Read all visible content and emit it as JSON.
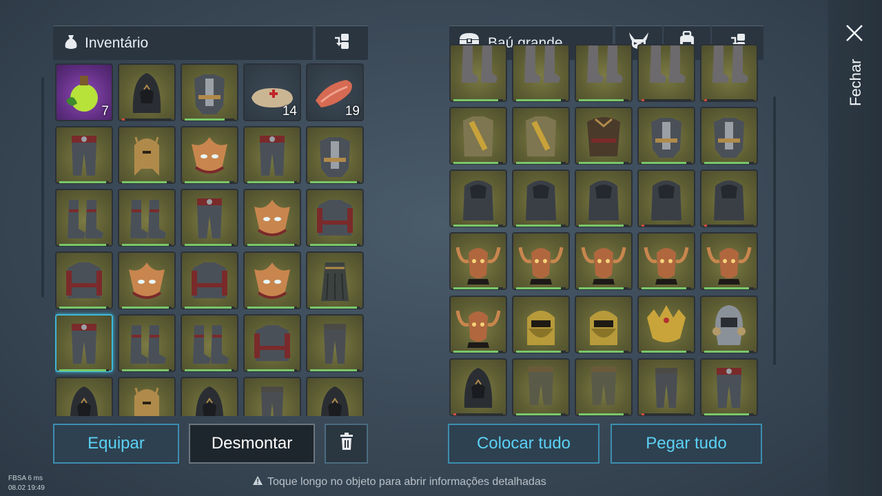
{
  "inventory": {
    "title": "Inventário",
    "icon": "pouch-icon",
    "sort_icon": "sort-icon",
    "items": [
      {
        "kind": "potion",
        "rarity": "rare",
        "qty": "7"
      },
      {
        "kind": "hood",
        "rarity": "normal",
        "durability": 0.05
      },
      {
        "kind": "chestplate",
        "rarity": "normal",
        "durability": 0.8
      },
      {
        "kind": "bandage",
        "rarity": "plain",
        "qty": "14"
      },
      {
        "kind": "meat",
        "rarity": "plain",
        "qty": "19"
      },
      {
        "kind": "pants",
        "rarity": "normal",
        "durability": 0.95
      },
      {
        "kind": "helmet-gold",
        "rarity": "normal",
        "durability": 0.9
      },
      {
        "kind": "mask",
        "rarity": "normal",
        "durability": 0.9
      },
      {
        "kind": "pants",
        "rarity": "normal",
        "durability": 0.95
      },
      {
        "kind": "chestplate",
        "rarity": "normal",
        "durability": 0.95
      },
      {
        "kind": "boots",
        "rarity": "normal",
        "durability": 0.95
      },
      {
        "kind": "boots",
        "rarity": "normal",
        "durability": 0.95
      },
      {
        "kind": "pants",
        "rarity": "normal",
        "durability": 0.95
      },
      {
        "kind": "mask",
        "rarity": "normal",
        "durability": 0.95
      },
      {
        "kind": "jacket",
        "rarity": "normal",
        "durability": 0.95
      },
      {
        "kind": "jacket",
        "rarity": "normal",
        "durability": 0.95
      },
      {
        "kind": "mask",
        "rarity": "normal",
        "durability": 0.95
      },
      {
        "kind": "jacket",
        "rarity": "normal",
        "durability": 0.95
      },
      {
        "kind": "mask",
        "rarity": "normal",
        "durability": 0.95
      },
      {
        "kind": "skirt",
        "rarity": "normal",
        "durability": 0.95
      },
      {
        "kind": "pants",
        "rarity": "normal",
        "durability": 0.95,
        "selected": true
      },
      {
        "kind": "boots",
        "rarity": "normal",
        "durability": 0.95
      },
      {
        "kind": "boots",
        "rarity": "normal",
        "durability": 0.95
      },
      {
        "kind": "jacket",
        "rarity": "normal",
        "durability": 0.95
      },
      {
        "kind": "leggings",
        "rarity": "normal",
        "durability": 0.95
      },
      {
        "kind": "hood",
        "rarity": "normal"
      },
      {
        "kind": "helmet-gold",
        "rarity": "normal"
      },
      {
        "kind": "hood",
        "rarity": "normal"
      },
      {
        "kind": "leggings",
        "rarity": "normal"
      },
      {
        "kind": "hood",
        "rarity": "normal"
      }
    ],
    "buttons": {
      "equip": "Equipar",
      "dismantle": "Desmontar",
      "delete_icon": "trash-icon"
    }
  },
  "chest": {
    "title": "Baú grande",
    "icon": "chest-icon",
    "filter_icons": [
      "horned-mask-icon",
      "backpack-icon",
      "sort-icon"
    ],
    "items": [
      {
        "kind": "greaves",
        "rarity": "normal",
        "durability": 0.9
      },
      {
        "kind": "greaves",
        "rarity": "normal",
        "durability": 0.9
      },
      {
        "kind": "greaves",
        "rarity": "normal",
        "durability": 0.9
      },
      {
        "kind": "greaves",
        "rarity": "normal",
        "durability": 0.05
      },
      {
        "kind": "greaves",
        "rarity": "normal",
        "durability": 0.05
      },
      {
        "kind": "tunic",
        "rarity": "normal",
        "durability": 0.9
      },
      {
        "kind": "tunic",
        "rarity": "normal",
        "durability": 0.9
      },
      {
        "kind": "robe",
        "rarity": "normal",
        "durability": 0.9
      },
      {
        "kind": "chestplate",
        "rarity": "normal",
        "durability": 0.9
      },
      {
        "kind": "chestplate",
        "rarity": "normal",
        "durability": 0.9
      },
      {
        "kind": "cloak",
        "rarity": "normal",
        "durability": 0.9
      },
      {
        "kind": "cloak",
        "rarity": "normal",
        "durability": 0.9
      },
      {
        "kind": "cloak",
        "rarity": "normal",
        "durability": 0.9
      },
      {
        "kind": "cloak",
        "rarity": "normal",
        "durability": 0.05
      },
      {
        "kind": "cloak",
        "rarity": "normal",
        "durability": 0.05
      },
      {
        "kind": "demon-head",
        "rarity": "normal",
        "durability": 0.9
      },
      {
        "kind": "demon-head",
        "rarity": "normal",
        "durability": 0.9
      },
      {
        "kind": "demon-head",
        "rarity": "normal",
        "durability": 0.9
      },
      {
        "kind": "demon-head",
        "rarity": "normal",
        "durability": 0.9
      },
      {
        "kind": "demon-head",
        "rarity": "normal",
        "durability": 0.9
      },
      {
        "kind": "demon-head",
        "rarity": "normal",
        "durability": 0.9
      },
      {
        "kind": "veil",
        "rarity": "normal",
        "durability": 0.9
      },
      {
        "kind": "veil",
        "rarity": "normal",
        "durability": 0.9
      },
      {
        "kind": "crown",
        "rarity": "normal",
        "durability": 0.9
      },
      {
        "kind": "helmet-silver",
        "rarity": "normal",
        "durability": 0.9
      },
      {
        "kind": "hood",
        "rarity": "normal",
        "durability": 0.05
      },
      {
        "kind": "trousers",
        "rarity": "normal",
        "durability": 0.9
      },
      {
        "kind": "trousers",
        "rarity": "normal",
        "durability": 0.9
      },
      {
        "kind": "leggings",
        "rarity": "normal",
        "durability": 0.05
      },
      {
        "kind": "pants",
        "rarity": "normal",
        "durability": 0.9
      }
    ],
    "buttons": {
      "put_all": "Colocar tudo",
      "take_all": "Pegar tudo"
    }
  },
  "close": {
    "label": "Fechar",
    "icon": "close-icon"
  },
  "hint": {
    "icon": "warning-icon",
    "text": "Toque longo no objeto para abrir informações detalhadas"
  },
  "perf": {
    "line1": "FBSA 6 ms",
    "line2": "08.02 19:49"
  },
  "colors": {
    "accent_teal": "#5bd1f5",
    "durability_ok": "#79c86a",
    "durability_low": "#d24b3f",
    "cell_bg": "#5f5f34"
  }
}
